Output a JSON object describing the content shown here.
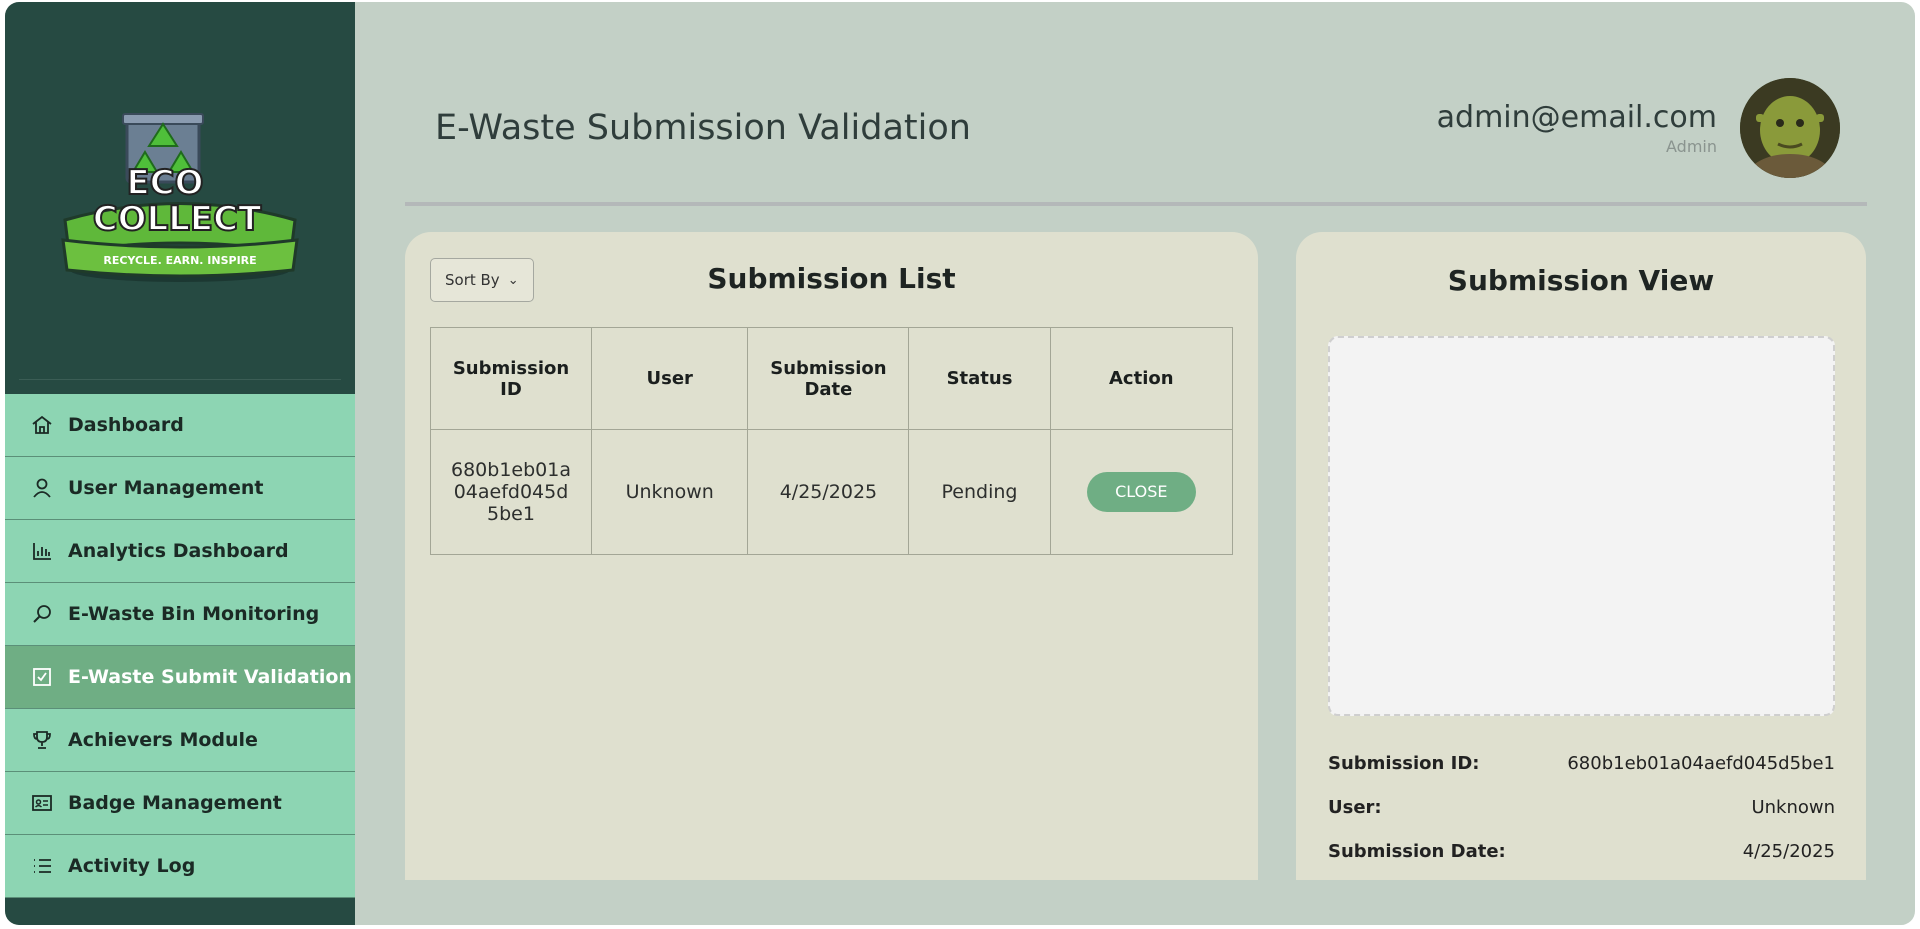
{
  "app": {
    "logo_text": [
      "ECO",
      "COLLECT"
    ],
    "logo_tagline": "RECYCLE. EARN. INSPIRE"
  },
  "sidebar": {
    "items": [
      {
        "label": "Dashboard",
        "icon": "home-icon",
        "active": false
      },
      {
        "label": "User Management",
        "icon": "user-icon",
        "active": false
      },
      {
        "label": "Analytics Dashboard",
        "icon": "bar-chart-icon",
        "active": false
      },
      {
        "label": "E-Waste Bin Monitoring",
        "icon": "search-bin-icon",
        "active": false
      },
      {
        "label": "E-Waste Submit Validation",
        "icon": "checkbox-icon",
        "active": true
      },
      {
        "label": "Achievers Module",
        "icon": "trophy-icon",
        "active": false
      },
      {
        "label": "Badge Management",
        "icon": "id-card-icon",
        "active": false
      },
      {
        "label": "Activity Log",
        "icon": "list-icon",
        "active": false
      }
    ]
  },
  "header": {
    "title": "E-Waste Submission Validation",
    "user_email": "admin@email.com",
    "user_role": "Admin"
  },
  "submission_list": {
    "title": "Submission List",
    "sort_label": "Sort By",
    "columns": [
      "Submission ID",
      "User",
      "Submission Date",
      "Status",
      "Action"
    ],
    "rows": [
      {
        "id": "680b1eb01a04aefd045d5be1",
        "user": "Unknown",
        "date": "4/25/2025",
        "status": "Pending",
        "action": "CLOSE"
      }
    ]
  },
  "submission_view": {
    "title": "Submission View",
    "fields": [
      {
        "label": "Submission ID:",
        "value": "680b1eb01a04aefd045d5be1"
      },
      {
        "label": "User:",
        "value": "Unknown"
      },
      {
        "label": "Submission Date:",
        "value": "4/25/2025"
      }
    ]
  },
  "colors": {
    "sidebar_bg": "#264a42",
    "nav_bg": "#8dd5b3",
    "nav_active": "#6fae84",
    "page_bg": "#c3d0c6",
    "panel_bg": "#dfe0cf"
  }
}
